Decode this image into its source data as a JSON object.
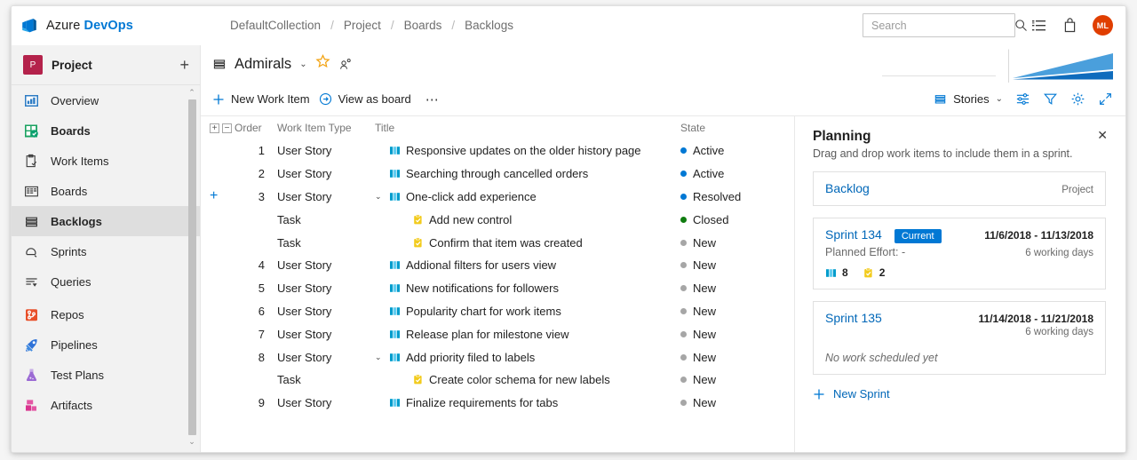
{
  "brand": {
    "prefix": "Azure ",
    "bold": "DevOps",
    "logo_icon": "azure-devops-logo"
  },
  "breadcrumb": {
    "items": [
      "DefaultCollection",
      "Project",
      "Boards",
      "Backlogs"
    ],
    "separator": "/"
  },
  "search": {
    "placeholder": "Search",
    "value": "",
    "icon": "search-icon"
  },
  "topbar_icons": [
    {
      "name": "work-list-icon"
    },
    {
      "name": "shopping-bag-icon"
    }
  ],
  "user": {
    "initials": "ML",
    "avatar_color": "#e03e00"
  },
  "sidebar": {
    "project": {
      "name": "Project",
      "badge_letter": "P",
      "badge_color": "#b4224b",
      "add_label": "+"
    },
    "items": [
      {
        "label": "Overview",
        "icon": "overview-icon",
        "selected": false,
        "bold": false
      },
      {
        "label": "Boards",
        "icon": "boards-hub-icon",
        "selected": false,
        "bold": true
      },
      {
        "label": "Work Items",
        "icon": "work-items-icon",
        "selected": false,
        "bold": false
      },
      {
        "label": "Boards",
        "icon": "board-grid-icon",
        "selected": false,
        "bold": false
      },
      {
        "label": "Backlogs",
        "icon": "backlogs-icon",
        "selected": true,
        "bold": true
      },
      {
        "label": "Sprints",
        "icon": "sprints-icon",
        "selected": false,
        "bold": false
      },
      {
        "label": "Queries",
        "icon": "queries-icon",
        "selected": false,
        "bold": false
      },
      {
        "label": "Repos",
        "icon": "repos-icon",
        "selected": false,
        "bold": false
      },
      {
        "label": "Pipelines",
        "icon": "pipelines-icon",
        "selected": false,
        "bold": false
      },
      {
        "label": "Test Plans",
        "icon": "test-plans-icon",
        "selected": false,
        "bold": false
      },
      {
        "label": "Artifacts",
        "icon": "artifacts-icon",
        "selected": false,
        "bold": false
      }
    ],
    "scrollbar": {
      "up": "⌃",
      "down": "⌄"
    }
  },
  "main_header": {
    "team": "Admirals",
    "team_icon": "backlog-icon",
    "chevron": "⌄",
    "favorite_icon": "star-icon",
    "team_members_icon": "team-members-icon"
  },
  "toolbar": {
    "new_work_item": "New Work Item",
    "new_work_item_icon": "plus-icon",
    "view_as_board": "View as board",
    "view_as_board_icon": "arrow-circle-right-icon",
    "more_icon": "⋯",
    "backlog_level": "Stories",
    "backlog_level_icon": "backlog-icon",
    "backlog_level_chevron": "⌄",
    "column_options_icon": "column-options-icon",
    "filter_icon": "filter-icon",
    "settings_icon": "gear-icon",
    "fullscreen_icon": "fullscreen-icon"
  },
  "grid": {
    "expand_all_icon": "+",
    "collapse_all_icon": "−",
    "columns": [
      "Order",
      "Work Item Type",
      "Title",
      "State"
    ],
    "rows": [
      {
        "order": "1",
        "type": "User Story",
        "title": "Responsive updates on the older history page",
        "state": "Active",
        "state_color": "#0078d4",
        "icon": "user-story-icon",
        "indent": 0,
        "chevron": "",
        "add_child": false
      },
      {
        "order": "2",
        "type": "User Story",
        "title": "Searching through cancelled orders",
        "state": "Active",
        "state_color": "#0078d4",
        "icon": "user-story-icon",
        "indent": 0,
        "chevron": "",
        "add_child": false
      },
      {
        "order": "3",
        "type": "User Story",
        "title": "One-click add experience",
        "state": "Resolved",
        "state_color": "#0078d4",
        "icon": "user-story-icon",
        "indent": 0,
        "chevron": "⌄",
        "add_child": true
      },
      {
        "order": "",
        "type": "Task",
        "title": "Add new control",
        "state": "Closed",
        "state_color": "#107c10",
        "icon": "task-icon",
        "indent": 1,
        "chevron": "",
        "add_child": false
      },
      {
        "order": "",
        "type": "Task",
        "title": "Confirm that item was created",
        "state": "New",
        "state_color": "#a6a6a6",
        "icon": "task-icon",
        "indent": 1,
        "chevron": "",
        "add_child": false
      },
      {
        "order": "4",
        "type": "User Story",
        "title": "Addional filters for users view",
        "state": "New",
        "state_color": "#a6a6a6",
        "icon": "user-story-icon",
        "indent": 0,
        "chevron": "",
        "add_child": false
      },
      {
        "order": "5",
        "type": "User Story",
        "title": "New notifications for followers",
        "state": "New",
        "state_color": "#a6a6a6",
        "icon": "user-story-icon",
        "indent": 0,
        "chevron": "",
        "add_child": false
      },
      {
        "order": "6",
        "type": "User Story",
        "title": "Popularity chart for work items",
        "state": "New",
        "state_color": "#a6a6a6",
        "icon": "user-story-icon",
        "indent": 0,
        "chevron": "",
        "add_child": false
      },
      {
        "order": "7",
        "type": "User Story",
        "title": "Release plan for milestone view",
        "state": "New",
        "state_color": "#a6a6a6",
        "icon": "user-story-icon",
        "indent": 0,
        "chevron": "",
        "add_child": false
      },
      {
        "order": "8",
        "type": "User Story",
        "title": "Add priority filed to labels",
        "state": "New",
        "state_color": "#a6a6a6",
        "icon": "user-story-icon",
        "indent": 0,
        "chevron": "⌄",
        "add_child": false
      },
      {
        "order": "",
        "type": "Task",
        "title": "Create color schema for new labels",
        "state": "New",
        "state_color": "#a6a6a6",
        "icon": "task-icon",
        "indent": 1,
        "chevron": "",
        "add_child": false
      },
      {
        "order": "9",
        "type": "User Story",
        "title": "Finalize requirements for tabs",
        "state": "New",
        "state_color": "#a6a6a6",
        "icon": "user-story-icon",
        "indent": 0,
        "chevron": "",
        "add_child": false
      }
    ]
  },
  "planning": {
    "title": "Planning",
    "subtitle": "Drag and drop work items to include them in a sprint.",
    "close_icon": "✕",
    "backlog_card": {
      "name": "Backlog",
      "scope": "Project"
    },
    "sprints": [
      {
        "name": "Sprint 134",
        "tag": "Current",
        "dates": "11/6/2018 - 11/13/2018",
        "working_days": "6 working days",
        "planned_effort": "Planned Effort: -",
        "counts": [
          {
            "icon": "user-story-icon",
            "value": "8"
          },
          {
            "icon": "task-icon",
            "value": "2"
          }
        ],
        "empty_text": ""
      },
      {
        "name": "Sprint 135",
        "tag": "",
        "dates": "11/14/2018 - 11/21/2018",
        "working_days": "6 working days",
        "planned_effort": "",
        "counts": [],
        "empty_text": "No work scheduled yet"
      }
    ],
    "new_sprint": {
      "label": "New Sprint",
      "icon": "plus-icon"
    }
  },
  "colors": {
    "accent": "#0078d4",
    "link": "#0067b8",
    "closed": "#107c10",
    "new": "#a6a6a6"
  }
}
